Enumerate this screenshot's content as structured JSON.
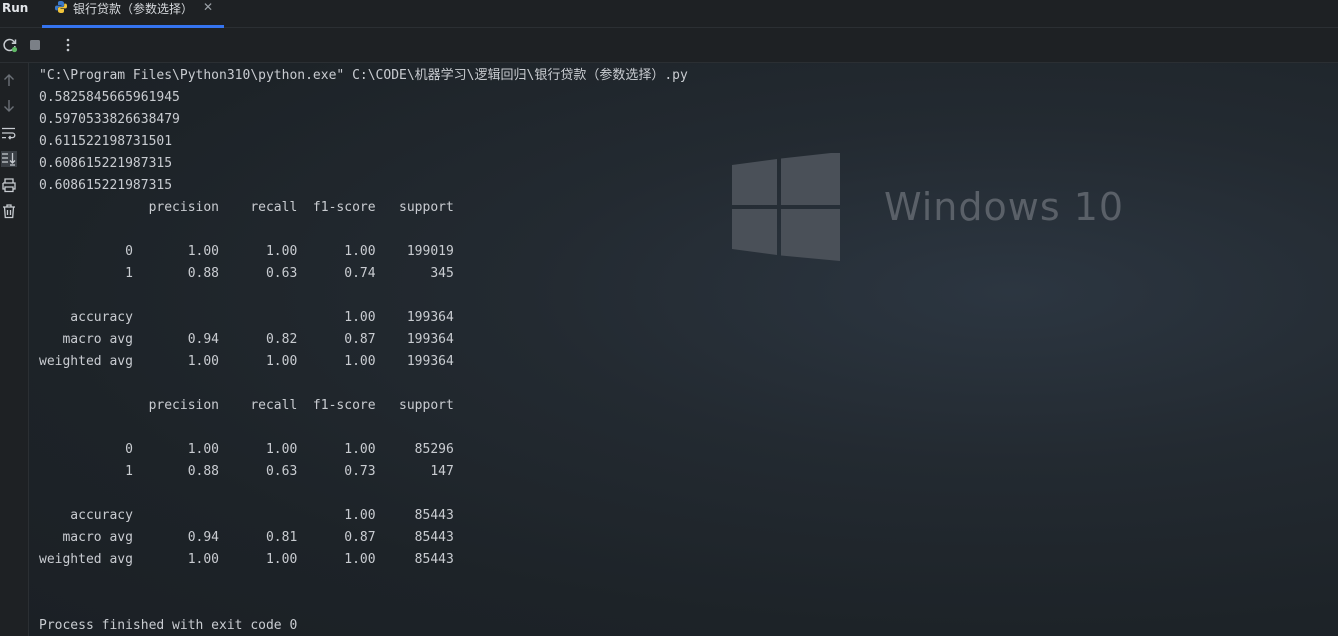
{
  "run_panel": {
    "label": "Run",
    "tab": {
      "title": "银行贷款（参数选择）",
      "icon": "python-file-icon"
    }
  },
  "toolbar": {
    "icons": [
      "rerun-icon",
      "stop-icon",
      "more-options-icon"
    ]
  },
  "gutter": {
    "icons": [
      "arrow-up-icon",
      "arrow-down-icon",
      "soft-wrap-icon",
      "scroll-to-end-icon",
      "print-icon",
      "trash-icon"
    ]
  },
  "watermark": {
    "text": "Windows 10"
  },
  "colors": {
    "accent": "#3574f0",
    "background": "#1f2327",
    "text": "#c9ccd1"
  },
  "console": {
    "lines": [
      "\"C:\\Program Files\\Python310\\python.exe\" C:\\CODE\\机器学习\\逻辑回归\\银行贷款（参数选择）.py",
      "0.5825845665961945",
      "0.5970533826638479",
      "0.611522198731501",
      "0.608615221987315",
      "0.608615221987315",
      "              precision    recall  f1-score   support",
      "",
      "           0       1.00      1.00      1.00    199019",
      "           1       0.88      0.63      0.74       345",
      "",
      "    accuracy                           1.00    199364",
      "   macro avg       0.94      0.82      0.87    199364",
      "weighted avg       1.00      1.00      1.00    199364",
      "",
      "              precision    recall  f1-score   support",
      "",
      "           0       1.00      1.00      1.00     85296",
      "           1       0.88      0.63      0.73       147",
      "",
      "    accuracy                           1.00     85443",
      "   macro avg       0.94      0.81      0.87     85443",
      "weighted avg       1.00      1.00      1.00     85443",
      "",
      "",
      "Process finished with exit code 0"
    ]
  }
}
